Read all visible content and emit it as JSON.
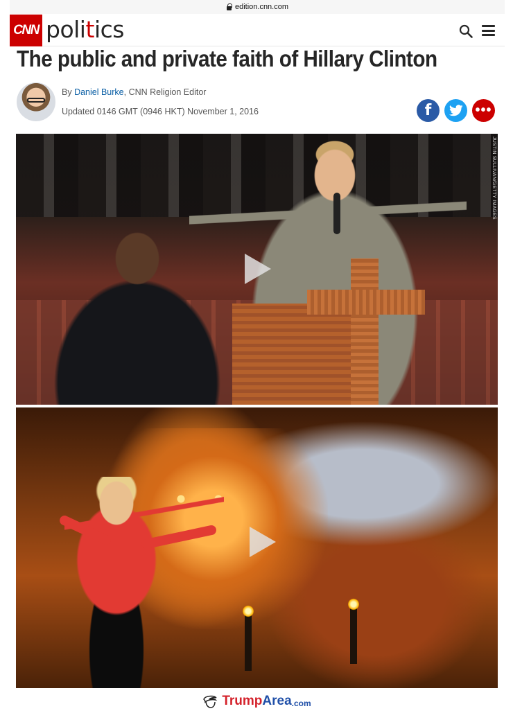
{
  "browser": {
    "url": "edition.cnn.com"
  },
  "header": {
    "logo_text": "CNN",
    "section_pre": "poli",
    "section_accent": "t",
    "section_post": "ics"
  },
  "article": {
    "headline": "The public and private faith of Hillary Clinton",
    "byline_prefix": "By ",
    "author": "Daniel Burke",
    "author_role": ", CNN Religion Editor",
    "updated": "Updated 0146 GMT (0946 HKT) November 1, 2016",
    "photo_credit": "JUSTIN SULLIVAN/GETTY IMAGES"
  },
  "share": {
    "facebook_glyph": "f",
    "more_glyph": "•••"
  },
  "watermark": {
    "brand_red": "Trump",
    "brand_blue": "Area",
    "tld": ".com"
  },
  "colors": {
    "cnn_red": "#cc0000",
    "facebook": "#2a5aa6",
    "twitter": "#1da1f2",
    "link": "#0b5fa5"
  }
}
